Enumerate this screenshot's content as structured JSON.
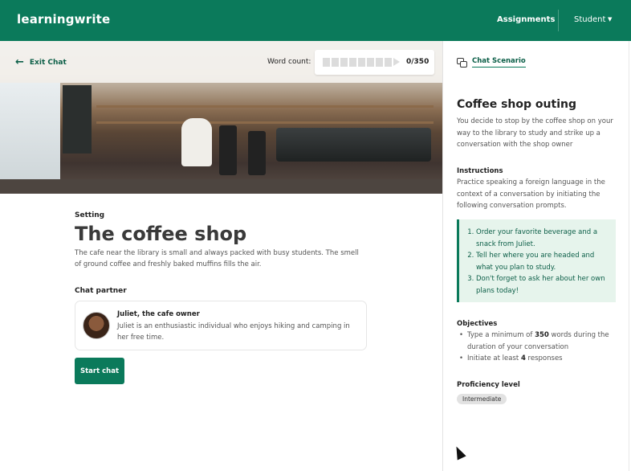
{
  "header": {
    "logo": "learningwrite",
    "nav_assignments": "Assignments",
    "nav_student": "Student"
  },
  "toolbar": {
    "exit_label": "Exit Chat",
    "word_count_label": "Word count:",
    "word_count_value": "0/350",
    "word_count_progress": 0
  },
  "setting": {
    "label": "Setting",
    "title": "The coffee shop",
    "description": "The cafe near the library is small and always packed with busy students. The smell of ground coffee and freshly baked muffins fills the air."
  },
  "partner": {
    "label": "Chat partner",
    "name": "Juliet, the cafe owner",
    "description": "Juliet is an enthusiastic individual who enjoys hiking and camping in her free time."
  },
  "start_button": "Start chat",
  "sidebar": {
    "tab_label": "Chat Scenario",
    "title": "Coffee shop outing",
    "description": "You decide to stop by the coffee shop on your way to the library to study and strike up a conversation with the shop owner",
    "instructions_label": "Instructions",
    "instructions_text": "Practice speaking a foreign language in the context of a conversation by initiating the following conversation prompts.",
    "prompts": [
      "Order your favorite beverage and a snack from Juliet.",
      "Tell her where you are headed and what you plan to study.",
      "Don't forget to ask her about her own plans today!"
    ],
    "objectives_label": "Objectives",
    "objectives": [
      {
        "pre": "Type a minimum of ",
        "bold": "350",
        "post": " words during the duration of your conversation"
      },
      {
        "pre": "Initiate at least ",
        "bold": "4",
        "post": " responses"
      }
    ],
    "proficiency_label": "Proficiency level",
    "proficiency_value": "Intermediate"
  }
}
